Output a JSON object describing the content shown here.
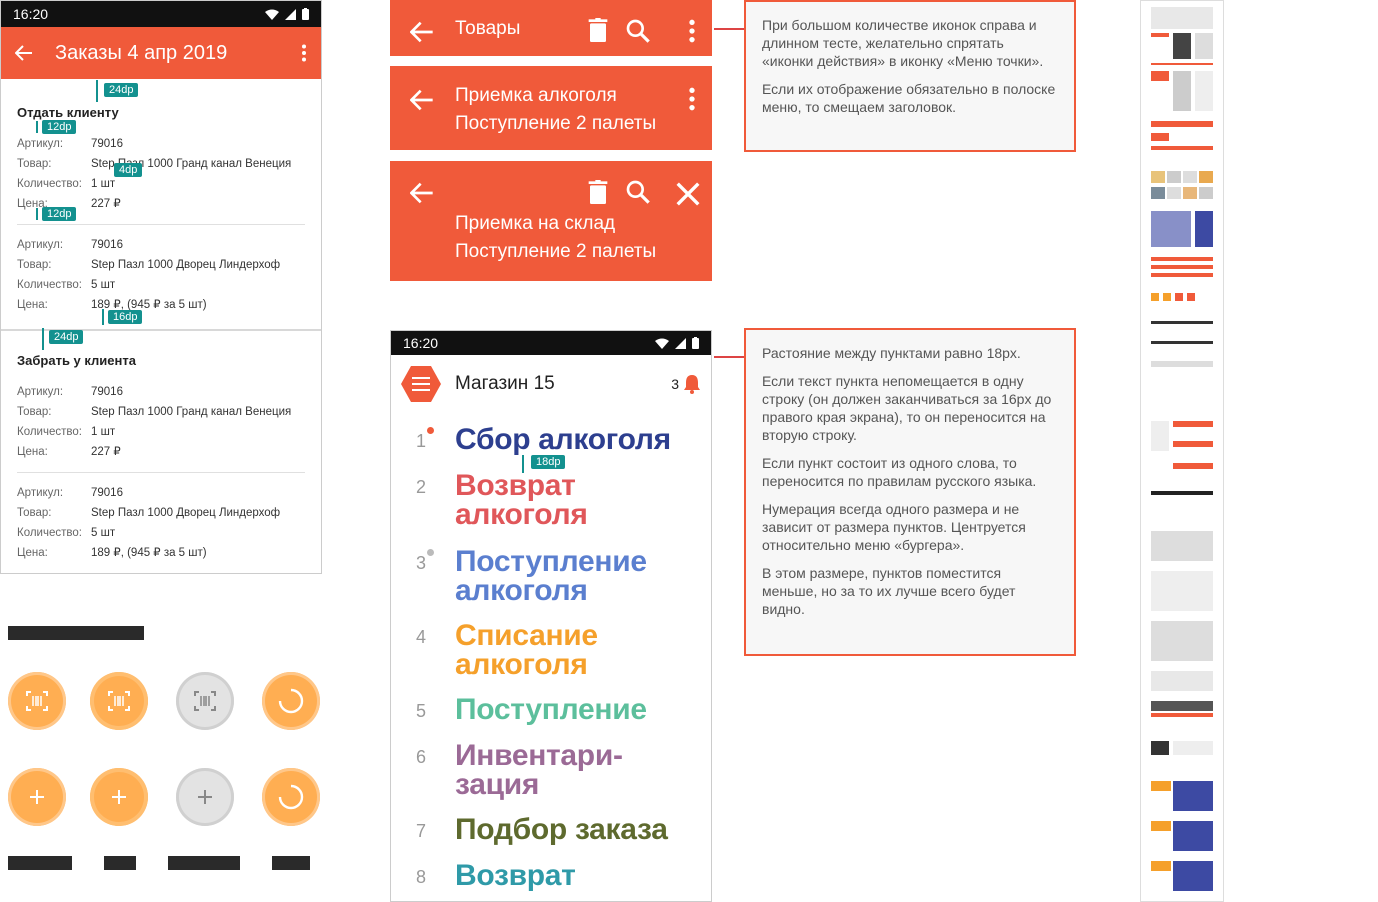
{
  "phone1": {
    "time": "16:20",
    "title": "Заказы 4 апр 2019",
    "sections": [
      {
        "title": "Отдать клиенту",
        "items": [
          {
            "article_label": "Артикул:",
            "article": "79016",
            "product_label": "Товар:",
            "product": "Step Пазл 1000 Гранд канал Венеция",
            "qty_label": "Количество:",
            "qty": "1 шт",
            "price_label": "Цена:",
            "price": "227 ₽"
          },
          {
            "article_label": "Артикул:",
            "article": "79016",
            "product_label": "Товар:",
            "product": "Step Пазл 1000 Дворец Линдерхоф",
            "qty_label": "Количество:",
            "qty": "5 шт",
            "price_label": "Цена:",
            "price": "189 ₽, (945 ₽ за 5 шт)"
          }
        ]
      },
      {
        "title": "Забрать у клиента",
        "items": [
          {
            "article_label": "Артикул:",
            "article": "79016",
            "product_label": "Товар:",
            "product": "Step Пазл 1000 Гранд канал Венеция",
            "qty_label": "Количество:",
            "qty": "1 шт",
            "price_label": "Цена:",
            "price": "227 ₽"
          },
          {
            "article_label": "Артикул:",
            "article": "79016",
            "product_label": "Товар:",
            "product": "Step Пазл 1000 Дворец Линдерхоф",
            "qty_label": "Количество:",
            "qty": "5 шт",
            "price_label": "Цена:",
            "price": "189 ₽, (945 ₽ за 5 шт)"
          }
        ]
      }
    ],
    "spacing_tags": [
      "24dp",
      "12dp",
      "4dp",
      "12dp",
      "16dp",
      "24dp"
    ]
  },
  "toolbars": {
    "bar1_title": "Товары",
    "bar2_line1": "Приемка алкоголя",
    "bar2_line2": "Поступление 2 палеты",
    "bar3_line1": "Приемка на склад",
    "bar3_line2": "Поступление 2 палеты"
  },
  "note1": {
    "p1": "При большом количестве иконок справа и длинном тесте, желательно спрятать «иконки действия» в иконку «Меню точки».",
    "p2": "Если их отображение обязательно в полоске меню, то смещаем заголовок."
  },
  "note2": {
    "p1": "Растояние между пунктами равно 18px.",
    "p2": "Если текст пункта непомещается в одну строку (он должен заканчиваться за 16px до правого края экрана), то он переносится на вторую строку.",
    "p3": "Если пункт состоит из одного слова, то переносится по правилам русского языка.",
    "p4": "Нумерация всегда одного размера и не зависит от размера пунктов. Центруется относительно меню «бургера».",
    "p5": "В этом размере, пунктов поместится меньше, но за то их лучше всего будет видно."
  },
  "phone2": {
    "time": "16:20",
    "store": "Магазин 15",
    "notif_count": "3",
    "spacing_tag": "18dp",
    "items": [
      {
        "num": "1",
        "line1": "Сбор алкоголя",
        "line2": "",
        "color": "#2d3f8f"
      },
      {
        "num": "2",
        "line1": "Возврат",
        "line2": "алкоголя",
        "color": "#e0575a"
      },
      {
        "num": "3",
        "line1": "Поступление",
        "line2": "алкоголя",
        "color": "#5b7fcf"
      },
      {
        "num": "4",
        "line1": "Списание",
        "line2": "алкоголя",
        "color": "#f5a02b"
      },
      {
        "num": "5",
        "line1": "Поступление",
        "line2": "",
        "color": "#5cbf9c"
      },
      {
        "num": "6",
        "line1": "Инвентари-",
        "line2": "зация",
        "color": "#9b6a96"
      },
      {
        "num": "7",
        "line1": "Подбор заказа",
        "line2": "",
        "color": "#5e6a2e"
      },
      {
        "num": "8",
        "line1": "Возврат",
        "line2": "",
        "color": "#2f9aa8"
      }
    ]
  },
  "colors": {
    "accent": "#f05a3a",
    "tag": "#13918f",
    "fab_orange": "#ffae52",
    "fab_gray": "#e3e3e3"
  }
}
